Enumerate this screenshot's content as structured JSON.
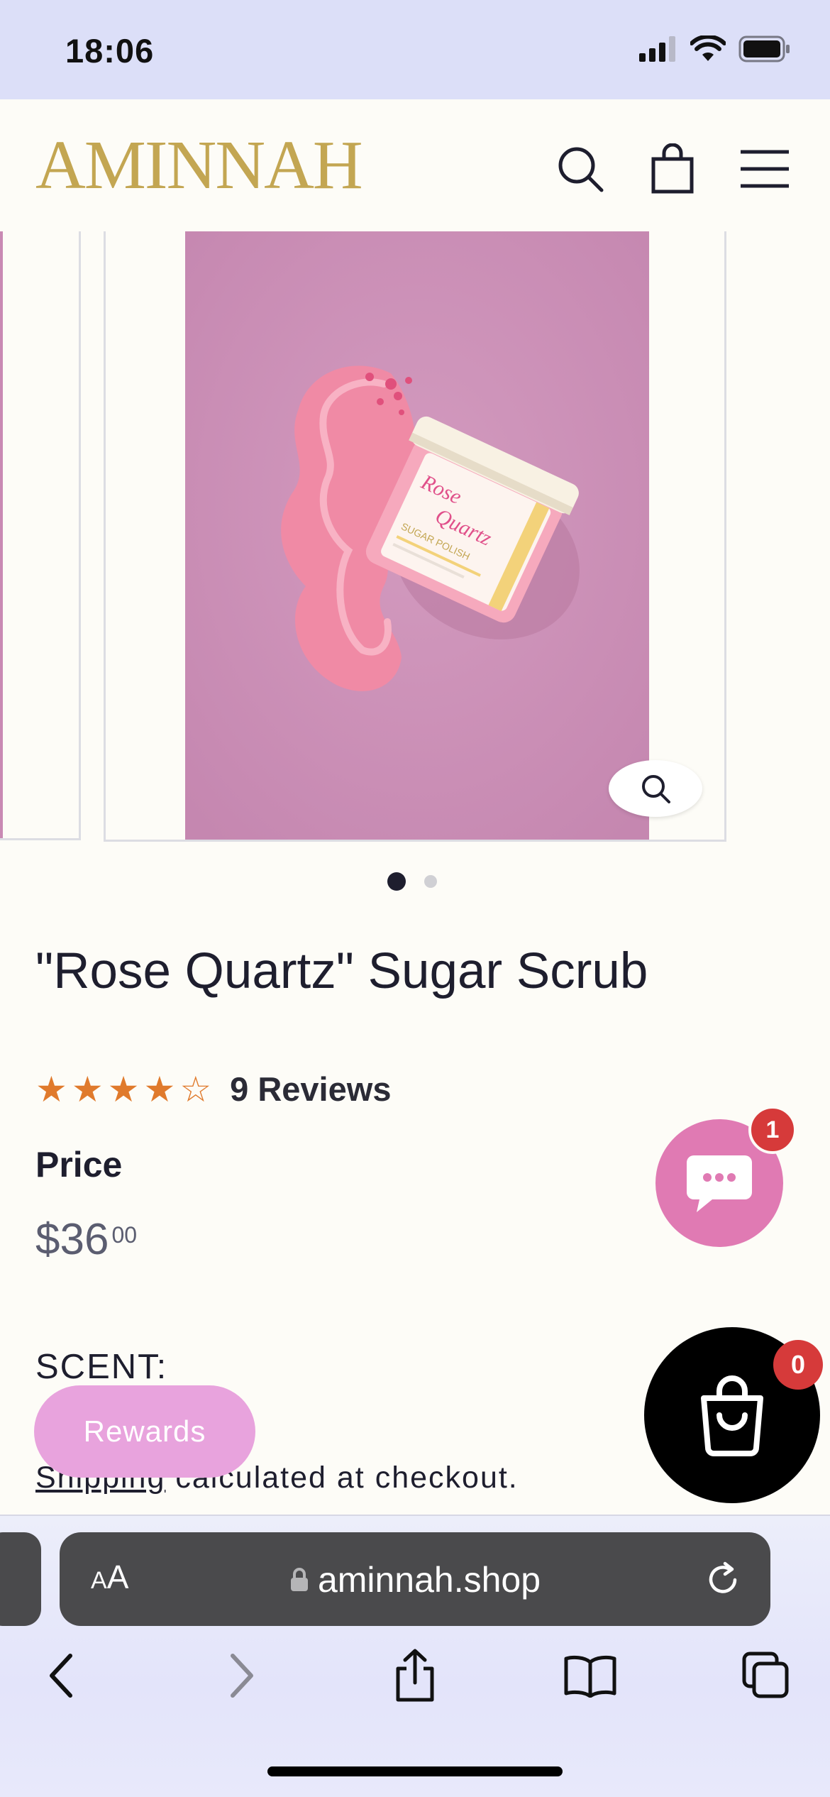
{
  "status_bar": {
    "time": "18:06"
  },
  "header": {
    "logo_text": "AMINNAH",
    "icons": [
      "search-icon",
      "bag-icon",
      "menu-icon"
    ]
  },
  "gallery": {
    "slide_count": 2,
    "active_index": 0
  },
  "product": {
    "title": "\"Rose Quartz\" Sugar Scrub",
    "rating": 4,
    "rating_max": 5,
    "reviews_text": "9 Reviews",
    "price_label": "Price",
    "price_main": "$36",
    "price_cents": "00",
    "scent_label": "SCENT:",
    "shipping_link": "Shipping",
    "shipping_rest": " calculated at checkout."
  },
  "widgets": {
    "rewards_label": "Rewards",
    "chat_badge": "1",
    "cart_badge": "0"
  },
  "browser": {
    "aa_label_big": "A",
    "aa_label_small": "A",
    "url": "aminnah.shop"
  },
  "colors": {
    "accent_gold": "#c3a652",
    "star": "#e07a2c",
    "chat": "#e07ab3",
    "rewards": "#e8a3dd",
    "badge": "#d63a3a"
  }
}
